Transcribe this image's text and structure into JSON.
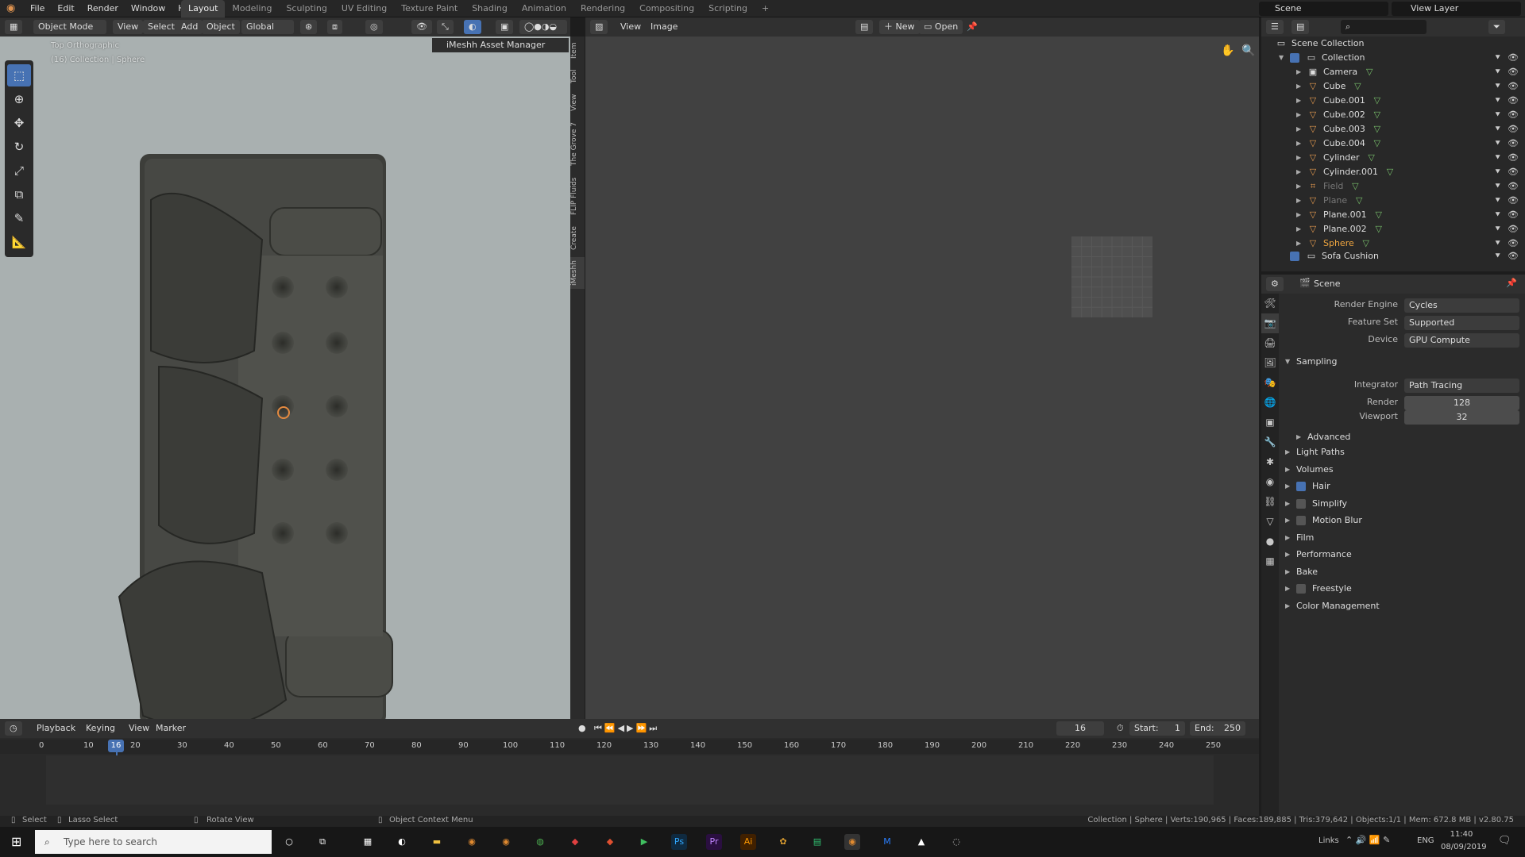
{
  "menu": [
    "File",
    "Edit",
    "Render",
    "Window",
    "Help"
  ],
  "workspaces": [
    "Layout",
    "Modeling",
    "Sculpting",
    "UV Editing",
    "Texture Paint",
    "Shading",
    "Animation",
    "Rendering",
    "Compositing",
    "Scripting",
    "+"
  ],
  "scene_name": "Scene",
  "view_layer": "View Layer",
  "viewport": {
    "mode": "Object Mode",
    "menus": [
      "View",
      "Select",
      "Add",
      "Object"
    ],
    "transform": "Global",
    "view_name": "Top Orthographic",
    "collection_info": "(16) Collection | Sphere",
    "asset_manager": "iMeshh Asset Manager",
    "side_tabs": [
      "Item",
      "Tool",
      "View",
      "The Grove 7",
      "FLIP Fluids",
      "Create",
      "iMeshh"
    ]
  },
  "image_editor": {
    "menus": [
      "View",
      "Image"
    ],
    "new_label": "New",
    "open_label": "Open"
  },
  "outliner": {
    "root": "Scene Collection",
    "collection": "Collection",
    "items": [
      {
        "name": "Camera",
        "type": "camera"
      },
      {
        "name": "Cube",
        "type": "mesh"
      },
      {
        "name": "Cube.001",
        "type": "mesh"
      },
      {
        "name": "Cube.002",
        "type": "mesh"
      },
      {
        "name": "Cube.003",
        "type": "mesh"
      },
      {
        "name": "Cube.004",
        "type": "mesh"
      },
      {
        "name": "Cylinder",
        "type": "mesh"
      },
      {
        "name": "Cylinder.001",
        "type": "mesh"
      },
      {
        "name": "Field",
        "type": "field"
      },
      {
        "name": "Plane",
        "type": "mesh"
      },
      {
        "name": "Plane.001",
        "type": "mesh"
      },
      {
        "name": "Plane.002",
        "type": "mesh"
      },
      {
        "name": "Sphere",
        "type": "mesh"
      }
    ],
    "extra_collection": "Sofa Cushion"
  },
  "properties": {
    "context": "Scene",
    "render_engine_label": "Render Engine",
    "render_engine": "Cycles",
    "feature_set_label": "Feature Set",
    "feature_set": "Supported",
    "device_label": "Device",
    "device": "GPU Compute",
    "sampling": "Sampling",
    "integrator_label": "Integrator",
    "integrator": "Path Tracing",
    "render_label": "Render",
    "render_samples": "128",
    "viewport_label": "Viewport",
    "viewport_samples": "32",
    "advanced": "Advanced",
    "sections": [
      {
        "label": "Light Paths"
      },
      {
        "label": "Volumes"
      },
      {
        "label": "Hair",
        "check": true
      },
      {
        "label": "Simplify",
        "check": false
      },
      {
        "label": "Motion Blur",
        "check": false
      },
      {
        "label": "Film"
      },
      {
        "label": "Performance"
      },
      {
        "label": "Bake"
      },
      {
        "label": "Freestyle",
        "check": false
      },
      {
        "label": "Color Management"
      }
    ]
  },
  "timeline": {
    "menus": [
      "Playback",
      "Keying",
      "View",
      "Marker"
    ],
    "current_frame": "16",
    "start_label": "Start:",
    "start": "1",
    "end_label": "End:",
    "end": "250",
    "ticks": [
      "0",
      "10",
      "20",
      "30",
      "40",
      "50",
      "60",
      "70",
      "80",
      "90",
      "100",
      "110",
      "120",
      "130",
      "140",
      "150",
      "160",
      "170",
      "180",
      "190",
      "200",
      "210",
      "220",
      "230",
      "240",
      "250"
    ]
  },
  "status": {
    "select": "Select",
    "lasso": "Lasso Select",
    "rotate": "Rotate View",
    "context_menu": "Object Context Menu",
    "stats": "Collection | Sphere | Verts:190,965 | Faces:189,885 | Tris:379,642 | Objects:1/1 | Mem: 672.8 MB | v2.80.75"
  },
  "taskbar": {
    "search_placeholder": "Type here to search",
    "links": "Links",
    "lang": "ENG",
    "time": "11:40",
    "date": "08/09/2019"
  }
}
